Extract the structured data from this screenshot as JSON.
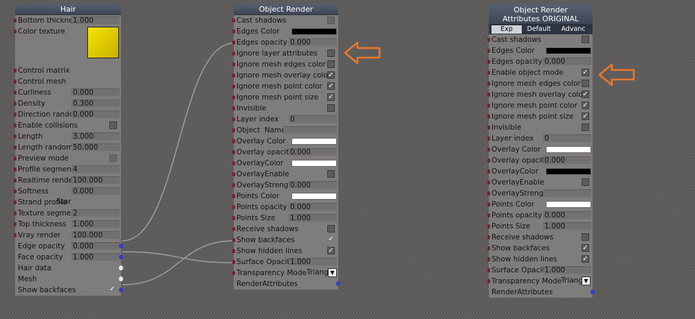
{
  "colors": {
    "accent_arrow": "#f07828",
    "wire": "#9aa0a4",
    "input_port": "#7a1e2a",
    "output_port": "#3040c8",
    "header": "#4a5463",
    "yellow_texture": "#e8d400"
  },
  "hair": {
    "title": "Hair",
    "rows": [
      {
        "label": "Bottom thicknes",
        "value": "1.000"
      },
      {
        "label": "Color texture"
      },
      {
        "label": "Control matrix"
      },
      {
        "label": "Control mesh"
      },
      {
        "label": "Curliness",
        "value": "0.000"
      },
      {
        "label": "Density",
        "value": "0.300"
      },
      {
        "label": "Direction randor",
        "value": "0.000"
      },
      {
        "label": "Enable collisions"
      },
      {
        "label": "Length",
        "value": "3.000"
      },
      {
        "label": "Length randomiz",
        "value": "50.000"
      },
      {
        "label": "Preview mode"
      },
      {
        "label": "Profile segments",
        "value": "4"
      },
      {
        "label": "Realtime render",
        "value": "100.000"
      },
      {
        "label": "Softness",
        "value": "0.000"
      },
      {
        "label": "Strand profile",
        "value": "Star"
      },
      {
        "label": "Texture segmen",
        "value": "2"
      },
      {
        "label": "Top thickness",
        "value": "1.000"
      },
      {
        "label": "Vray render",
        "value": "100.000"
      },
      {
        "label": "Edge opacity",
        "value": "0.000"
      },
      {
        "label": "Face opacity",
        "value": "1.000"
      },
      {
        "label": "Hair data"
      },
      {
        "label": "Mesh"
      },
      {
        "label": "Show backfaces",
        "check": "✓"
      }
    ]
  },
  "object_render": {
    "title": "Object Render",
    "rows": [
      {
        "label": "Cast shadows"
      },
      {
        "label": "Edges Color"
      },
      {
        "label": "Edges opacity",
        "value": "0.000"
      },
      {
        "label": "Ignore layer attributes"
      },
      {
        "label": "Ignore mesh edges color"
      },
      {
        "label": "Ignore mesh overlay color",
        "check": "✓"
      },
      {
        "label": "Ignore mesh point color",
        "check": "✓"
      },
      {
        "label": "Ignore mesh point size",
        "check": "✓"
      },
      {
        "label": "Invisible"
      },
      {
        "label": "Layer index",
        "value": "0"
      },
      {
        "label": "Object  Name"
      },
      {
        "label": "Overlay Color"
      },
      {
        "label": "Overlay opacity",
        "value": "0.000"
      },
      {
        "label": "OverlayColor"
      },
      {
        "label": "OverlayEnable"
      },
      {
        "label": "OverlayStrengtl",
        "value": "0.000"
      },
      {
        "label": "Points Color"
      },
      {
        "label": "Points opacity",
        "value": "0.000"
      },
      {
        "label": "Points Size",
        "value": "1.000"
      },
      {
        "label": "Receive shadows"
      },
      {
        "label": "Show backfaces",
        "check": "✓"
      },
      {
        "label": "Show hidden lines",
        "check": "✓"
      },
      {
        "label": "Surface Opacity",
        "value": "1.000"
      },
      {
        "label": "Transparency Mode",
        "value": "Triang"
      },
      {
        "label": "RenderAttributes"
      }
    ]
  },
  "object_render_original": {
    "title_line1": "Object Render",
    "title_line2": "Attributes ORIGINAL",
    "tabs": [
      "Exp",
      "Default",
      "Advanc"
    ],
    "rows": [
      {
        "label": "Cast shadows"
      },
      {
        "label": "Edges Color"
      },
      {
        "label": "Edges opacity",
        "value": "0.000"
      },
      {
        "label": "Enable object mode",
        "check": "✓"
      },
      {
        "label": "Ignore mesh edges color"
      },
      {
        "label": "Ignore mesh overlay color",
        "check": "✓"
      },
      {
        "label": "Ignore mesh point color",
        "check": "✓"
      },
      {
        "label": "Ignore mesh point size",
        "check": "✓"
      },
      {
        "label": "Invisible"
      },
      {
        "label": "Layer index",
        "value": "0"
      },
      {
        "label": "Overlay Color"
      },
      {
        "label": "Overlay opacity",
        "value": "0.000"
      },
      {
        "label": "OverlayColor"
      },
      {
        "label": "OverlayEnable"
      },
      {
        "label": "OverlayStrengtl"
      },
      {
        "label": "Points Color"
      },
      {
        "label": "Points opacity",
        "value": "0.000"
      },
      {
        "label": "Points Size",
        "value": "1.000"
      },
      {
        "label": "Receive shadows"
      },
      {
        "label": "Show backfaces",
        "check": "✓"
      },
      {
        "label": "Show hidden lines",
        "check": "✓"
      },
      {
        "label": "Surface Opacity",
        "value": "1.000"
      },
      {
        "label": "Transparency Mode",
        "value": "Triang"
      },
      {
        "label": "RenderAttributes"
      }
    ]
  }
}
